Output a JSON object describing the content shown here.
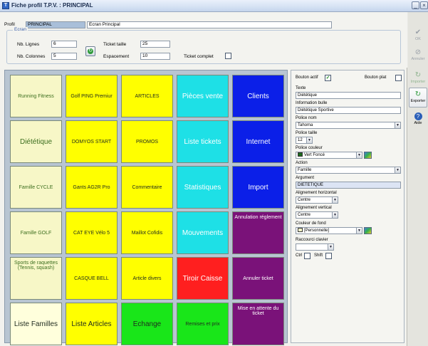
{
  "window": {
    "title": "Fiche profil T.P.V. : PRINCIPAL"
  },
  "header": {
    "profil_label": "Profil",
    "profil_code": "PRINCIPAL",
    "profil_name": "Ecran Principal",
    "group_label": "Ecran",
    "nb_lignes_label": "Nb. Lignes",
    "nb_lignes_value": "6",
    "nb_colonnes_label": "Nb. Colonnes",
    "nb_colonnes_value": "5",
    "ticket_taille_label": "Ticket taille",
    "ticket_taille_value": "25",
    "espacement_label": "Espacement",
    "espacement_value": "10",
    "ticket_complet_label": "Ticket complet"
  },
  "tiles": [
    {
      "label": "Running Fitness",
      "bg": "#f7f7c7",
      "fg": "#3c6e1e",
      "size": 7
    },
    {
      "label": "Golf PING Premiur",
      "bg": "#ffff00",
      "fg": "#1f2a1f",
      "size": 7
    },
    {
      "label": "ARTICLES",
      "bg": "#ffff00",
      "fg": "#1f2a1f",
      "size": 7
    },
    {
      "label": "Pièces vente",
      "bg": "#1ee0e6",
      "fg": "#ffffff",
      "size": 10
    },
    {
      "label": "Clients",
      "bg": "#0b1fe8",
      "fg": "#ffffff",
      "size": 10
    },
    {
      "label": "Diététique",
      "bg": "#f7f7c7",
      "fg": "#3c6e1e",
      "size": 10
    },
    {
      "label": "DOMYOS START",
      "bg": "#ffff00",
      "fg": "#1f2a1f",
      "size": 7
    },
    {
      "label": "PROMOS",
      "bg": "#ffff00",
      "fg": "#1f2a1f",
      "size": 7
    },
    {
      "label": "Liste tickets",
      "bg": "#1ee0e6",
      "fg": "#ffffff",
      "size": 10
    },
    {
      "label": "Internet",
      "bg": "#0b1fe8",
      "fg": "#ffffff",
      "size": 10
    },
    {
      "label": "Famille CYCLE",
      "bg": "#f7f7c7",
      "fg": "#3c6e1e",
      "size": 7
    },
    {
      "label": "Gants AG2R Pro",
      "bg": "#ffff00",
      "fg": "#1f2a1f",
      "size": 7
    },
    {
      "label": "Commentaire",
      "bg": "#ffff00",
      "fg": "#1f2a1f",
      "size": 7
    },
    {
      "label": "Statistiques",
      "bg": "#1ee0e6",
      "fg": "#ffffff",
      "size": 10
    },
    {
      "label": "Import",
      "bg": "#0b1fe8",
      "fg": "#ffffff",
      "size": 10
    },
    {
      "label": "Famille GOLF",
      "bg": "#f7f7c7",
      "fg": "#3c6e1e",
      "size": 7
    },
    {
      "label": "CAT EYE Vélo 5",
      "bg": "#ffff00",
      "fg": "#1f2a1f",
      "size": 7
    },
    {
      "label": "Maillot Cofidis",
      "bg": "#ffff00",
      "fg": "#1f2a1f",
      "size": 7
    },
    {
      "label": "Mouvements",
      "bg": "#1ee0e6",
      "fg": "#ffffff",
      "size": 10
    },
    {
      "label": "Annulation réglement",
      "bg": "#7a1279",
      "fg": "#ffffff",
      "size": 7,
      "top": true
    },
    {
      "label": "Sports de raquettes (Tennis, squash)",
      "bg": "#f7f7c7",
      "fg": "#3c6e1e",
      "size": 7,
      "top": true
    },
    {
      "label": "CASQUE BELL",
      "bg": "#ffff00",
      "fg": "#1f2a1f",
      "size": 7
    },
    {
      "label": "Article divers",
      "bg": "#ffff00",
      "fg": "#1f2a1f",
      "size": 7
    },
    {
      "label": "Tiroir Caisse",
      "bg": "#ff1f1f",
      "fg": "#ffffff",
      "size": 10
    },
    {
      "label": "Annuler ticket",
      "bg": "#7a1279",
      "fg": "#ffffff",
      "size": 7
    },
    {
      "label": "Liste Familles",
      "bg": "#ffffdc",
      "fg": "#1f2a1f",
      "size": 10
    },
    {
      "label": "Liste Articles",
      "bg": "#ffff00",
      "fg": "#1f2a1f",
      "size": 10
    },
    {
      "label": "Echange",
      "bg": "#19e619",
      "fg": "#1f2a1f",
      "size": 10
    },
    {
      "label": "Remises et prix",
      "bg": "#19e619",
      "fg": "#1f2a1f",
      "size": 7
    },
    {
      "label": "Mise en attente du ticket",
      "bg": "#7a1279",
      "fg": "#ffffff",
      "size": 7,
      "top": true
    }
  ],
  "props": {
    "bouton_actif_label": "Bouton actif",
    "bouton_plat_label": "Bouton plat",
    "texte_label": "Texte",
    "texte_value": "Diététique",
    "info_bulle_label": "Information bulle",
    "info_bulle_value": "Diététique Sportive",
    "police_nom_label": "Police nom",
    "police_nom_value": "Tahoma",
    "police_taille_label": "Police taille",
    "police_taille_value": "12",
    "police_couleur_label": "Police couleur",
    "police_couleur_value": "Vert Foncé",
    "police_couleur_swatch": "#1e6b1e",
    "action_label": "Action",
    "action_value": "Famille",
    "argument_label": "Argument",
    "argument_value": "DIETETIQUE",
    "align_h_label": "Alignement horizontal",
    "align_h_value": "Centre",
    "align_v_label": "Alignement vertical",
    "align_v_value": "Centre",
    "couleur_fond_label": "Couleur de fond",
    "couleur_fond_value": "[Personnelle]",
    "couleur_fond_swatch": "#f7f7c7",
    "raccourci_label": "Raccourci clavier",
    "ctrl_label": "Ctrl",
    "shift_label": "Shift"
  },
  "toolbar": {
    "ok": "OK",
    "annuler": "Annuler",
    "importer": "Importer",
    "exporter": "Exporter",
    "aide": "Aide"
  }
}
